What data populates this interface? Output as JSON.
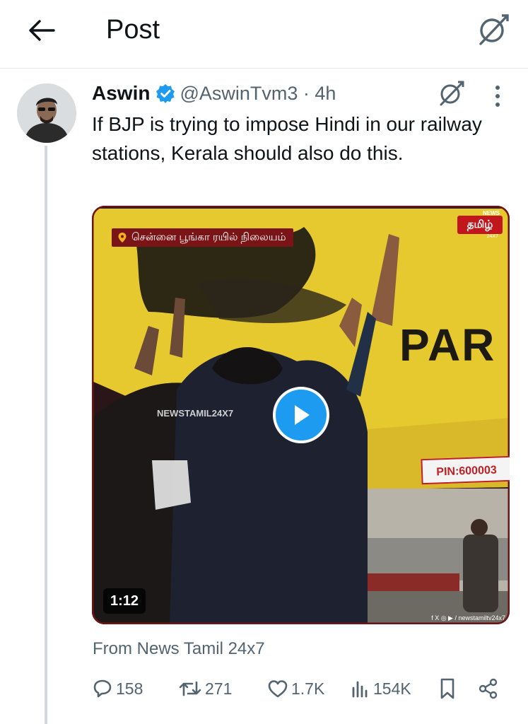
{
  "header": {
    "title": "Post"
  },
  "tweet": {
    "author_name": "Aswin",
    "handle": "@AswinTvm3",
    "time": "4h",
    "text": "If BJP is trying to impose Hindi in our railway stations, Kerala should also do this.",
    "from_text": "From News Tamil 24x7"
  },
  "media": {
    "duration": "1:12",
    "caption": "சென்னை பூங்கா ரயில் நிலையம்",
    "watermark": "NEWSTAMIL24X7",
    "logo_news": "NEWS",
    "logo_main": "தமிழ்",
    "logo_247": "24X7",
    "sign_text": "PAR",
    "pin_text": "PIN:600003",
    "social_text": "f X ◎ ▶ / newstamiltv24x7"
  },
  "actions": {
    "replies": "158",
    "reposts": "271",
    "likes": "1.7K",
    "views": "154K"
  },
  "colors": {
    "accent": "#1d9bf0",
    "muted": "#536471",
    "text": "#0f1419"
  }
}
